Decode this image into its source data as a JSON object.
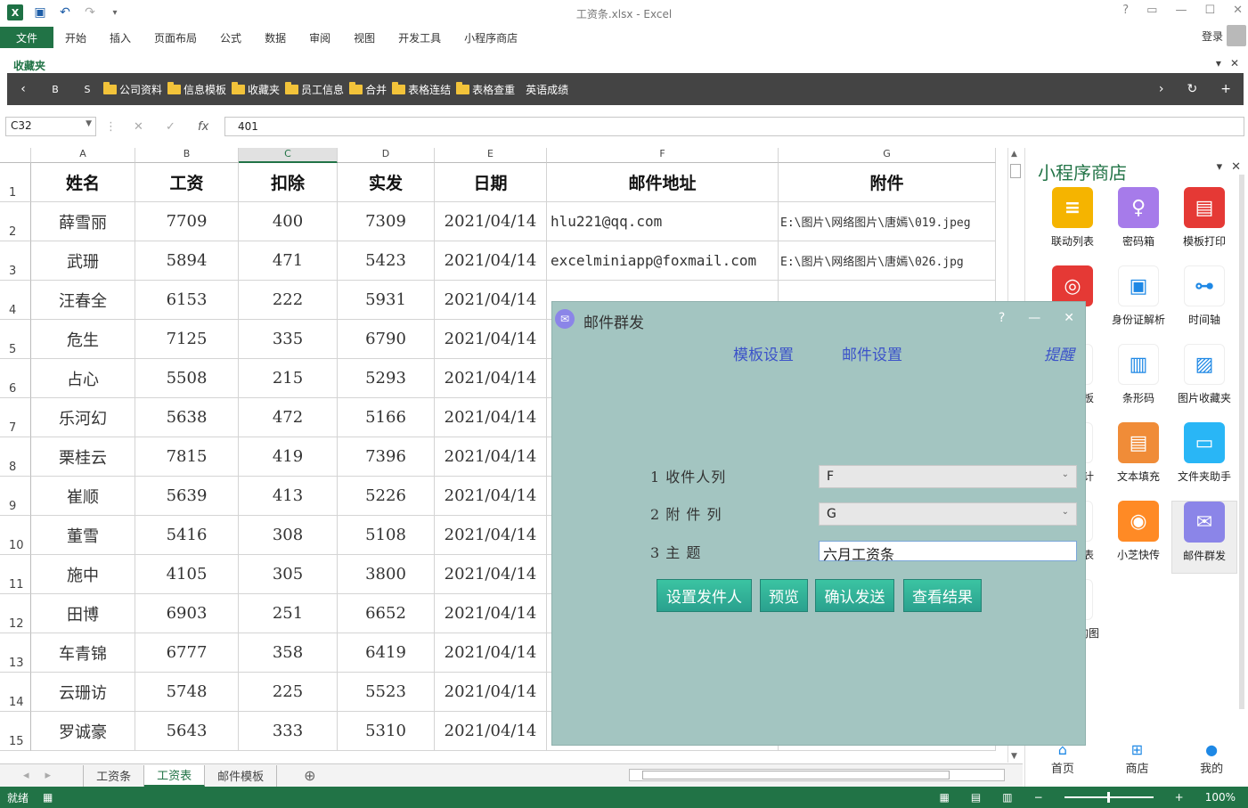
{
  "window": {
    "title": "工资条.xlsx - Excel"
  },
  "ribbon": {
    "file": "文件",
    "tabs": [
      "开始",
      "插入",
      "页面布局",
      "公式",
      "数据",
      "审阅",
      "视图",
      "开发工具",
      "小程序商店"
    ],
    "login": "登录"
  },
  "favorites": {
    "label": "收藏夹",
    "b": "B",
    "s": "S",
    "items": [
      "公司资料",
      "信息模板",
      "收藏夹",
      "员工信息",
      "合并",
      "表格连结",
      "表格查重"
    ],
    "extra": "英语成绩"
  },
  "formula": {
    "namebox": "C32",
    "value": "401"
  },
  "columns": [
    "A",
    "B",
    "C",
    "D",
    "E",
    "F",
    "G"
  ],
  "selected_column": "C",
  "table": {
    "headers": [
      "姓名",
      "工资",
      "扣除",
      "实发",
      "日期",
      "邮件地址",
      "附件"
    ],
    "rows": [
      [
        "薛雪丽",
        "7709",
        "400",
        "7309",
        "2021/04/14",
        "hlu221@qq.com",
        "E:\\图片\\网络图片\\唐嫣\\019.jpeg"
      ],
      [
        "武珊",
        "5894",
        "471",
        "5423",
        "2021/04/14",
        "excelminiapp@foxmail.com",
        "E:\\图片\\网络图片\\唐嫣\\026.jpg"
      ],
      [
        "汪春全",
        "6153",
        "222",
        "5931",
        "2021/04/14",
        "",
        ""
      ],
      [
        "危生",
        "7125",
        "335",
        "6790",
        "2021/04/14",
        "",
        ""
      ],
      [
        "占心",
        "5508",
        "215",
        "5293",
        "2021/04/14",
        "",
        ""
      ],
      [
        "乐河幻",
        "5638",
        "472",
        "5166",
        "2021/04/14",
        "",
        ""
      ],
      [
        "栗桂云",
        "7815",
        "419",
        "7396",
        "2021/04/14",
        "",
        ""
      ],
      [
        "崔顺",
        "5639",
        "413",
        "5226",
        "2021/04/14",
        "",
        ""
      ],
      [
        "董雪",
        "5416",
        "308",
        "5108",
        "2021/04/14",
        "",
        ""
      ],
      [
        "施中",
        "4105",
        "305",
        "3800",
        "2021/04/14",
        "",
        ""
      ],
      [
        "田博",
        "6903",
        "251",
        "6652",
        "2021/04/14",
        "",
        ""
      ],
      [
        "车青锦",
        "6777",
        "358",
        "6419",
        "2021/04/14",
        "",
        ""
      ],
      [
        "云珊访",
        "5748",
        "225",
        "5523",
        "2021/04/14",
        "",
        ""
      ],
      [
        "罗诚豪",
        "5643",
        "333",
        "5310",
        "2021/04/14",
        "",
        ""
      ]
    ]
  },
  "sheets": [
    "工资条",
    "工资表",
    "邮件模板"
  ],
  "active_sheet": "工资表",
  "status": {
    "ready": "就绪",
    "zoom": "100%"
  },
  "pane": {
    "title": "小程序商店",
    "apps": [
      {
        "label": "联动列表",
        "color": "#f5b400",
        "icon": "≡"
      },
      {
        "label": "密码箱",
        "color": "#a67bea",
        "icon": "♀"
      },
      {
        "label": "模板打印",
        "color": "#e53935",
        "icon": "▤"
      },
      {
        "label": "",
        "color": "#e53935",
        "icon": "◎"
      },
      {
        "label": "身份证解析",
        "color": "#ffffff",
        "icon": "▣"
      },
      {
        "label": "时间轴",
        "color": "#ffffff",
        "icon": "⊶"
      },
      {
        "label": "数据模板",
        "color": "#ffffff",
        "icon": "⬡"
      },
      {
        "label": "条形码",
        "color": "#ffffff",
        "icon": "▥"
      },
      {
        "label": "图片收藏夹",
        "color": "#ffffff",
        "icon": "▨"
      },
      {
        "label": "图形设计",
        "color": "#ffffff",
        "icon": "△"
      },
      {
        "label": "文本填充",
        "color": "#f08c38",
        "icon": "▤"
      },
      {
        "label": "文件夹助手",
        "color": "#29b6f6",
        "icon": "▭"
      },
      {
        "label": "下拉列表",
        "color": "#ffffff",
        "icon": "▼"
      },
      {
        "label": "小芝快传",
        "color": "#ff8a25",
        "icon": "◉"
      },
      {
        "label": "邮件群发",
        "color": "#8b85e8",
        "icon": "✉"
      },
      {
        "label": "组织结构图",
        "color": "#ffffff",
        "icon": "⊞"
      }
    ],
    "nav": [
      {
        "label": "首页",
        "icon": "⌂"
      },
      {
        "label": "商店",
        "icon": "⊞"
      },
      {
        "label": "我的",
        "icon": "●"
      }
    ]
  },
  "dialog": {
    "title": "邮件群发",
    "link_template": "模板设置",
    "link_mail": "邮件设置",
    "remind": "提醒",
    "field1_label": "1 收件人列",
    "field1_value": "F",
    "field2_label": "2 附 件 列",
    "field2_value": "G",
    "field3_label": "3 主   题",
    "field3_value": "六月工资条",
    "btn_sender": "设置发件人",
    "btn_preview": "预览",
    "btn_send": "确认发送",
    "btn_result": "查看结果"
  }
}
